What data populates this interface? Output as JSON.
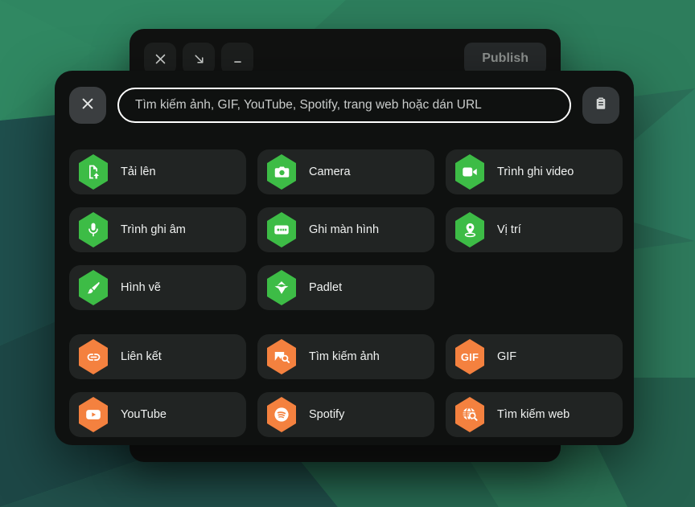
{
  "background_window": {
    "controls": [
      {
        "name": "close",
        "icon": "close-icon",
        "label": ""
      },
      {
        "name": "expand",
        "icon": "arrow-down-right-icon",
        "label": ""
      },
      {
        "name": "minimize",
        "icon": "minimize-icon",
        "label": ""
      }
    ],
    "publish_label": "Publish"
  },
  "picker": {
    "close_label": "",
    "close_icon": "close-icon",
    "paste_icon": "clipboard-icon",
    "search": {
      "value": "",
      "placeholder": "Tìm kiếm ảnh, GIF, YouTube, Spotify, trang web hoặc dán URL"
    },
    "groups": [
      {
        "name": "device-sources",
        "accent": "#3dbc46",
        "items": [
          {
            "label": "Tải lên",
            "icon": "upload-file-icon"
          },
          {
            "label": "Camera",
            "icon": "camera-icon"
          },
          {
            "label": "Trình ghi video",
            "icon": "video-recorder-icon"
          },
          {
            "label": "Trình ghi âm",
            "icon": "microphone-icon"
          },
          {
            "label": "Ghi màn hình",
            "icon": "screen-record-icon"
          },
          {
            "label": "Vị trí",
            "icon": "location-pin-icon"
          },
          {
            "label": "Hình vẽ",
            "icon": "paintbrush-icon"
          },
          {
            "label": "Padlet",
            "icon": "padlet-crane-icon"
          },
          {
            "label": "",
            "icon": ""
          }
        ]
      },
      {
        "name": "web-sources",
        "accent": "#f4813f",
        "items": [
          {
            "label": "Liên kết",
            "icon": "link-icon"
          },
          {
            "label": "Tìm kiếm ảnh",
            "icon": "image-search-icon"
          },
          {
            "label": "GIF",
            "icon": "gif-icon"
          },
          {
            "label": "YouTube",
            "icon": "youtube-icon"
          },
          {
            "label": "Spotify",
            "icon": "spotify-icon"
          },
          {
            "label": "Tìm kiếm web",
            "icon": "globe-search-icon"
          }
        ]
      }
    ]
  }
}
